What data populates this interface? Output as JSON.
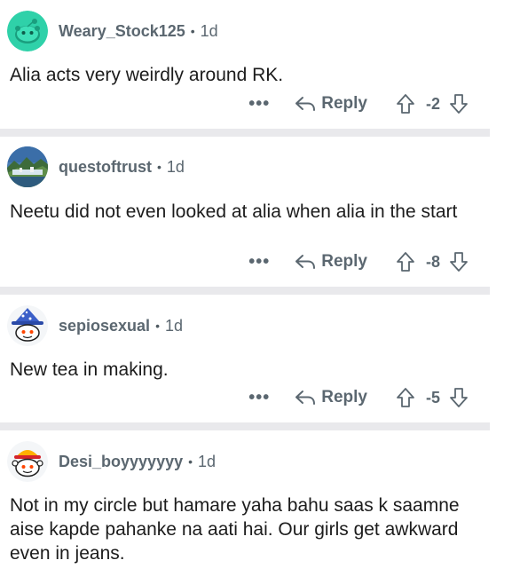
{
  "comments": [
    {
      "username": "Weary_Stock125",
      "age": "1d",
      "text": "Alia acts very weirdly around RK.",
      "score": "-2",
      "avatar": "snoo-teal-icon",
      "reply_label": "Reply"
    },
    {
      "username": "questoftrust",
      "age": "1d",
      "text": "Neetu did not even looked at alia when alia in the start",
      "score": "-8",
      "avatar": "landscape-photo",
      "reply_label": "Reply"
    },
    {
      "username": "sepiosexual",
      "age": "1d",
      "text": "New tea in making.",
      "score": "-5",
      "avatar": "snoo-wizard-icon",
      "reply_label": "Reply"
    },
    {
      "username": "Desi_boyyyyyyy",
      "age": "1d",
      "text": "Not in my circle but hamare yaha bahu saas k saamne aise kapde pahanke na aati hai. Our girls get awkward even in jeans.",
      "avatar": "snoo-hat-icon"
    }
  ],
  "separator": "•",
  "more_label": "•••",
  "colors": {
    "meta": "#5b6770",
    "separator_band": "#e9e9ec",
    "teal_avatar": "#2fd1a9"
  }
}
